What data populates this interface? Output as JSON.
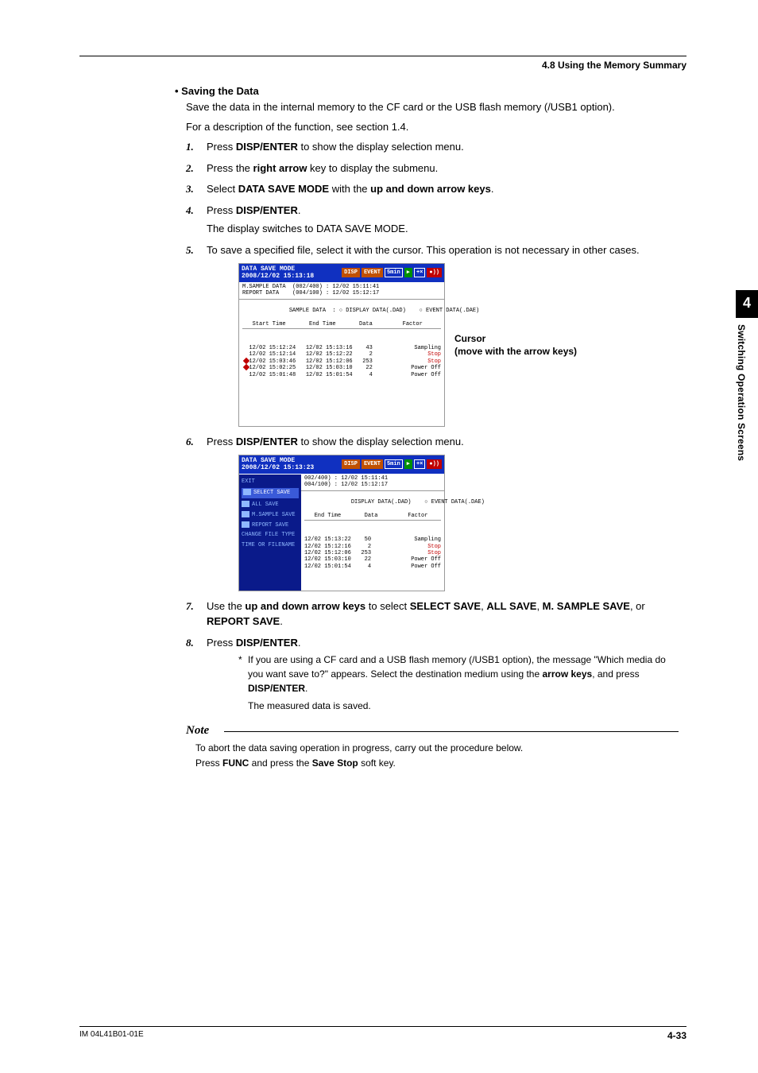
{
  "header": {
    "section": "4.8  Using the Memory Summary"
  },
  "sidebar": {
    "chapter": "4",
    "label": "Switching Operation Screens"
  },
  "footer": {
    "left": "IM 04L41B01-01E",
    "right": "4-33"
  },
  "body": {
    "heading": "Saving the Data",
    "p1": "Save the data in the internal memory to the CF card or the USB flash memory (/USB1 option).",
    "p2": "For a description of the function, see section 1.4.",
    "steps": {
      "s1a": "Press ",
      "s1b": "DISP/ENTER",
      "s1c": " to show the display selection menu.",
      "s2a": "Press the ",
      "s2b": "right arrow",
      "s2c": " key to display the submenu.",
      "s3a": "Select ",
      "s3b": "DATA SAVE MODE",
      "s3c": " with the ",
      "s3d": "up and down arrow keys",
      "s3e": ".",
      "s4a": "Press ",
      "s4b": "DISP/ENTER",
      "s4c": ".",
      "s4sub": "The display switches to DATA SAVE MODE.",
      "s5": "To save a specified file, select it with the cursor. This operation is not necessary in other cases.",
      "s6a": "Press ",
      "s6b": "DISP/ENTER",
      "s6c": " to show the display selection menu.",
      "s7a": "Use the ",
      "s7b": "up and down arrow keys",
      "s7c": " to select ",
      "s7d": "SELECT SAVE",
      "s7e": ", ",
      "s7f": "ALL SAVE",
      "s7g": ", ",
      "s7h": "M. SAMPLE SAVE",
      "s7i": ", or ",
      "s7j": "REPORT SAVE",
      "s7k": ".",
      "s8a": "Press ",
      "s8b": "DISP/ENTER",
      "s8c": ".",
      "s8star1a": "If you are using a CF card and a USB flash memory (/USB1 option), the message \"Which media do you want save to?\" appears. Select the destination medium using the ",
      "s8star1b": "arrow keys",
      "s8star1c": ", and press ",
      "s8star1d": "DISP/ENTER",
      "s8star1e": ".",
      "s8star2": "The measured data is saved."
    },
    "note": {
      "title": "Note",
      "l1": "To abort the data saving operation in progress, carry out the procedure below.",
      "l2a": "Press ",
      "l2b": "FUNC",
      "l2c": " and press the ",
      "l2d": "Save Stop",
      "l2e": " soft key."
    },
    "cursor_label_l1": "Cursor",
    "cursor_label_l2": "(move with the arrow keys)"
  },
  "shot1": {
    "title": "DATA SAVE MODE",
    "datetime": "2008/12/02 15:13:18",
    "badge1": "DISP",
    "badge2": "EVENT",
    "badge3": "5min",
    "badge4": "5min",
    "info": "M.SAMPLE DATA  (002/400) : 12/02 15:11:41\nREPORT DATA    (004/100) : 12/02 15:12:17",
    "colshdr1": "SAMPLE DATA  : ○ DISPLAY DATA(.DAD)    ○ EVENT DATA(.DAE)",
    "colshdr2": "   Start Time       End Time       Data         Factor",
    "rows": [
      {
        "t": "  12/02 15:12:24   12/02 15:13:16    43        Sampling",
        "f": "Sampling",
        "red": false
      },
      {
        "t": "  12/02 15:12:14   12/02 15:12:22     2        Stop",
        "f": "Stop",
        "red": true
      },
      {
        "t": "  12/02 15:03:46   12/02 15:12:06   253        Stop",
        "f": "Stop",
        "red": true
      },
      {
        "t": "  12/02 15:02:25   12/02 15:03:10    22        Power Off",
        "f": "Power Off",
        "red": false
      },
      {
        "t": "  12/02 15:01:48   12/02 15:01:54     4        Power Off",
        "f": "Power Off",
        "red": false
      }
    ]
  },
  "shot2": {
    "title": "DATA SAVE MODE",
    "datetime": "2008/12/02 15:13:23",
    "badge1": "DISP",
    "badge2": "EVENT",
    "badge3": "5min",
    "badge4": "5min",
    "info": "002/400) : 12/02 15:11:41\n004/100) : 12/02 15:12:17",
    "colshdr1": "DISPLAY DATA(.DAD)    ○ EVENT DATA(.DAE)",
    "colshdr2": "   End Time       Data         Factor",
    "rows": [
      {
        "t": "12/02 15:13:22    50        Sampling",
        "red": false
      },
      {
        "t": "12/02 15:12:16     2        Stop",
        "red": true
      },
      {
        "t": "12/02 15:12:06   253        Stop",
        "red": true
      },
      {
        "t": "12/02 15:03:10    22        Power Off",
        "red": false
      },
      {
        "t": "12/02 15:01:54     4        Power Off",
        "red": false
      }
    ],
    "menu": [
      "EXIT",
      "SELECT SAVE",
      "ALL SAVE",
      "M.SAMPLE SAVE",
      "REPORT SAVE",
      "CHANGE FILE TYPE",
      "TIME OR FILENAME"
    ],
    "menu_sel": 1
  }
}
